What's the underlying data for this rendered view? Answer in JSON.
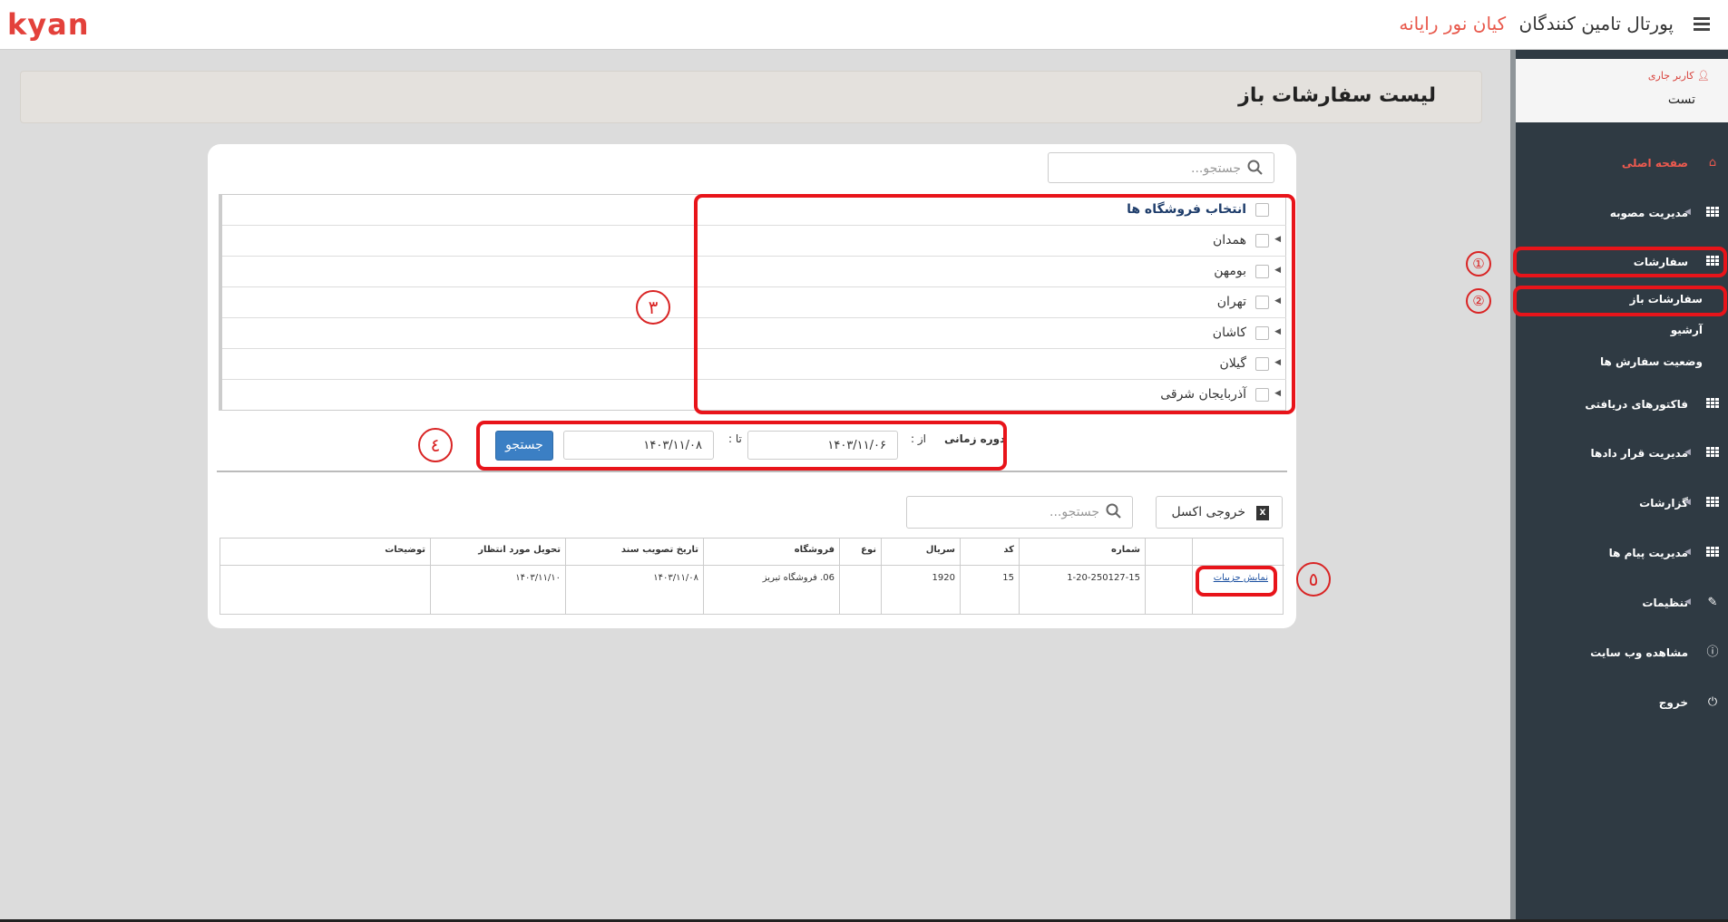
{
  "header": {
    "logo": "kyan",
    "portal_title": "پورتال تامین کنندگان",
    "brand_name": "کیان نور رایانه"
  },
  "sidebar": {
    "user_label": "کاربر جاری",
    "user_name": "تست",
    "items": [
      {
        "label": "صفحه اصلی",
        "icon": "home-icon"
      },
      {
        "label": "مدیریت مصوبه",
        "icon": "grid-icon"
      },
      {
        "label": "سفارشات",
        "icon": "grid-icon"
      },
      {
        "label": "سفارشات باز"
      },
      {
        "label": "آرشیو"
      },
      {
        "label": "وضعیت سفارش ها"
      },
      {
        "label": "فاکتورهای دریافتی",
        "icon": "grid-icon"
      },
      {
        "label": "مدیریت قرار دادها",
        "icon": "grid-icon"
      },
      {
        "label": "گزارشات",
        "icon": "grid-icon"
      },
      {
        "label": "مدیریت پیام ها",
        "icon": "grid-icon"
      },
      {
        "label": "تنظیمات",
        "icon": "edit-icon"
      },
      {
        "label": "مشاهده وب سایت",
        "icon": "info-icon"
      },
      {
        "label": "خروج",
        "icon": "power-icon"
      }
    ]
  },
  "page": {
    "title": "لیست سفارشات باز"
  },
  "store_filter": {
    "search_placeholder": "جستجو...",
    "header_label": "انتخاب فروشگاه ها",
    "stores": [
      "همدان",
      "بومهن",
      "تهران",
      "کاشان",
      "گیلان",
      "آذربایجان شرقی"
    ]
  },
  "date_filter": {
    "period_label": "دوره زمانی",
    "from_label": "از :",
    "to_label": "تا :",
    "from_value": "۱۴۰۳/۱۱/۰۶",
    "to_value": "۱۴۰۳/۱۱/۰۸",
    "search_button": "جستجو"
  },
  "results": {
    "excel_button": "خروجی اکسل",
    "search_placeholder": "جستجو...",
    "columns": [
      "",
      "شماره",
      "کد",
      "سریال",
      "نوع",
      "فروشگاه",
      "تاریخ تصویب سند",
      "تحویل مورد انتظار",
      "توضیحات"
    ],
    "rows": [
      {
        "action": "نمایش جزییات",
        "number": "1-20-250127-15",
        "code": "15",
        "serial": "1920",
        "type": "",
        "store": "06. فروشگاه تبریز",
        "approval_date": "۱۴۰۳/۱۱/۰۸",
        "expected_delivery": "۱۴۰۳/۱۱/۱۰",
        "description": ""
      }
    ]
  },
  "callouts": [
    "①",
    "②",
    "٣",
    "٤",
    "٥"
  ],
  "colors": {
    "accent": "#e8584b",
    "sidebar_bg": "#2f3a43",
    "annotation_red": "#e8141a",
    "button_blue": "#3b7fc4"
  }
}
